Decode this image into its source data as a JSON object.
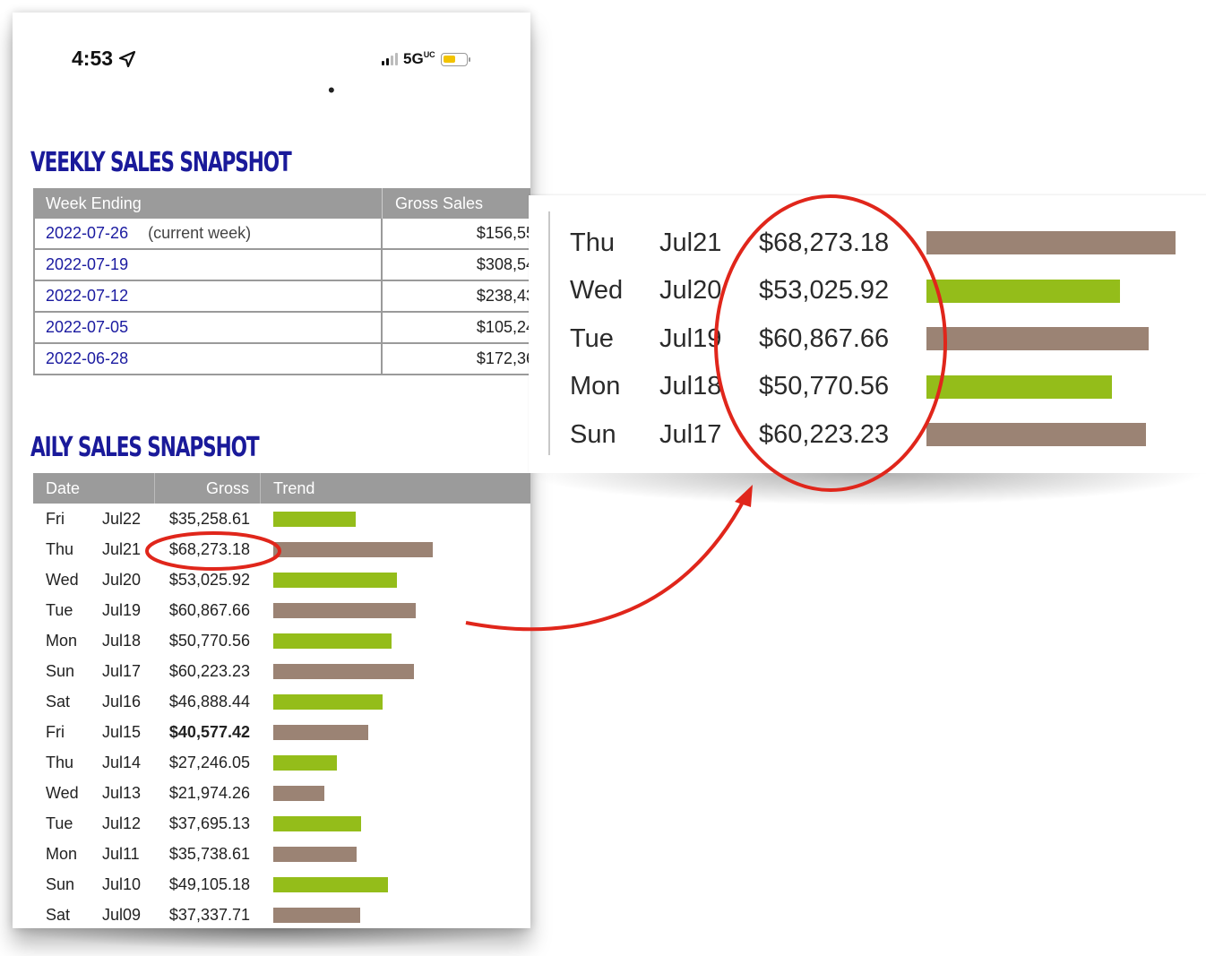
{
  "status_bar": {
    "time": "4:53",
    "network": "5G",
    "network_suffix": "UC"
  },
  "weekly": {
    "title": "VEEKLY SALES SNAPSHOT",
    "headers": [
      "Week Ending",
      "Gross Sales"
    ],
    "rows": [
      {
        "week": "2022-07-26",
        "note": "(current week)",
        "gross": "$156,55"
      },
      {
        "week": "2022-07-19",
        "note": "",
        "gross": "$308,54"
      },
      {
        "week": "2022-07-12",
        "note": "",
        "gross": "$238,43"
      },
      {
        "week": "2022-07-05",
        "note": "",
        "gross": "$105,24"
      },
      {
        "week": "2022-06-28",
        "note": "",
        "gross": "$172,36"
      }
    ]
  },
  "daily": {
    "title": "AILY SALES SNAPSHOT",
    "headers": [
      "Date",
      "Gross",
      "Trend"
    ],
    "rows": [
      {
        "day": "Fri",
        "date": "Jul22",
        "gross": "$35,258.61",
        "value": 35258.61,
        "color": "#94bd1a",
        "bold": false
      },
      {
        "day": "Thu",
        "date": "Jul21",
        "gross": "$68,273.18",
        "value": 68273.18,
        "color": "#9b8374",
        "bold": false
      },
      {
        "day": "Wed",
        "date": "Jul20",
        "gross": "$53,025.92",
        "value": 53025.92,
        "color": "#94bd1a",
        "bold": false
      },
      {
        "day": "Tue",
        "date": "Jul19",
        "gross": "$60,867.66",
        "value": 60867.66,
        "color": "#9b8374",
        "bold": false
      },
      {
        "day": "Mon",
        "date": "Jul18",
        "gross": "$50,770.56",
        "value": 50770.56,
        "color": "#94bd1a",
        "bold": false
      },
      {
        "day": "Sun",
        "date": "Jul17",
        "gross": "$60,223.23",
        "value": 60223.23,
        "color": "#9b8374",
        "bold": false
      },
      {
        "day": "Sat",
        "date": "Jul16",
        "gross": "$46,888.44",
        "value": 46888.44,
        "color": "#94bd1a",
        "bold": false
      },
      {
        "day": "Fri",
        "date": "Jul15",
        "gross": "$40,577.42",
        "value": 40577.42,
        "color": "#9b8374",
        "bold": true
      },
      {
        "day": "Thu",
        "date": "Jul14",
        "gross": "$27,246.05",
        "value": 27246.05,
        "color": "#94bd1a",
        "bold": false
      },
      {
        "day": "Wed",
        "date": "Jul13",
        "gross": "$21,974.26",
        "value": 21974.26,
        "color": "#9b8374",
        "bold": false
      },
      {
        "day": "Tue",
        "date": "Jul12",
        "gross": "$37,695.13",
        "value": 37695.13,
        "color": "#94bd1a",
        "bold": false
      },
      {
        "day": "Mon",
        "date": "Jul11",
        "gross": "$35,738.61",
        "value": 35738.61,
        "color": "#9b8374",
        "bold": false
      },
      {
        "day": "Sun",
        "date": "Jul10",
        "gross": "$49,105.18",
        "value": 49105.18,
        "color": "#94bd1a",
        "bold": false
      },
      {
        "day": "Sat",
        "date": "Jul09",
        "gross": "$37,337.71",
        "value": 37337.71,
        "color": "#9b8374",
        "bold": false
      }
    ]
  },
  "zoom": {
    "rows": [
      {
        "day": "Thu",
        "date": "Jul21",
        "gross": "$68,273.18",
        "value": 68273.18,
        "color": "#9b8374"
      },
      {
        "day": "Wed",
        "date": "Jul20",
        "gross": "$53,025.92",
        "value": 53025.92,
        "color": "#94bd1a"
      },
      {
        "day": "Tue",
        "date": "Jul19",
        "gross": "$60,867.66",
        "value": 60867.66,
        "color": "#9b8374"
      },
      {
        "day": "Mon",
        "date": "Jul18",
        "gross": "$50,770.56",
        "value": 50770.56,
        "color": "#94bd1a"
      },
      {
        "day": "Sun",
        "date": "Jul17",
        "gross": "$60,223.23",
        "value": 60223.23,
        "color": "#9b8374"
      }
    ]
  },
  "annotation_color": "#e0261b"
}
